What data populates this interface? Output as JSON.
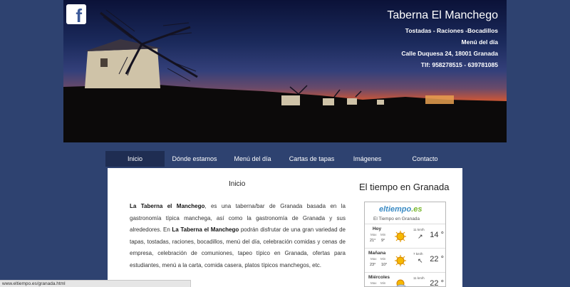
{
  "header": {
    "title": "Taberna El Manchego",
    "line1": "Tostadas - Raciones -Bocadillos",
    "line2": "Menú del día",
    "line3": "Calle Duquesa 24, 18001 Granada",
    "line4": "Tlf: 958278515 - 639781085",
    "facebook_icon": "facebook-icon"
  },
  "nav": {
    "items": [
      {
        "label": "Inicio"
      },
      {
        "label": "Dónde estamos"
      },
      {
        "label": "Menú del día"
      },
      {
        "label": "Cartas de tapas"
      },
      {
        "label": "Imágenes"
      },
      {
        "label": "Contacto"
      }
    ]
  },
  "content": {
    "title": "Inicio",
    "p_bold1": "La Taberna el Manchego",
    "p_text1": ", es una taberna/bar de Granada basada en la gastronomía típica manchega, así como la gastronomía de Granada y sus alrededores. En ",
    "p_bold2": "La Taberna el Manchego",
    "p_text2": " podrán disfrutar de una gran variedad de tapas, tostadas, raciones, bocadillos, menú del día, celebración comidas y cenas de empresa, celebración de comuniones, tapeo típico en Granada, ofertas para estudiantes, menú a la carta, comida casera, platos típicos manchegos, etc."
  },
  "weather": {
    "title": "El tiempo en Granada",
    "logo_main": "eltiempo",
    "logo_suffix": ".es",
    "subtitle": "El Tiempo en Granada",
    "max_label": "Max",
    "min_label": "Min",
    "days": [
      {
        "name": "Hoy",
        "max": "21°",
        "min": "9°",
        "wind": "11 km/h",
        "arrow": "↗",
        "temp": "14 °"
      },
      {
        "name": "Mañana",
        "max": "23°",
        "min": "10°",
        "wind": "7 km/h",
        "arrow": "↖",
        "temp": "22 °"
      },
      {
        "name": "Miércoles",
        "max": "",
        "min": "",
        "wind": "11 km/h",
        "arrow": "",
        "temp": "22 °"
      }
    ]
  },
  "statusbar": {
    "url": "www.eltiempo.es/granada.html"
  }
}
